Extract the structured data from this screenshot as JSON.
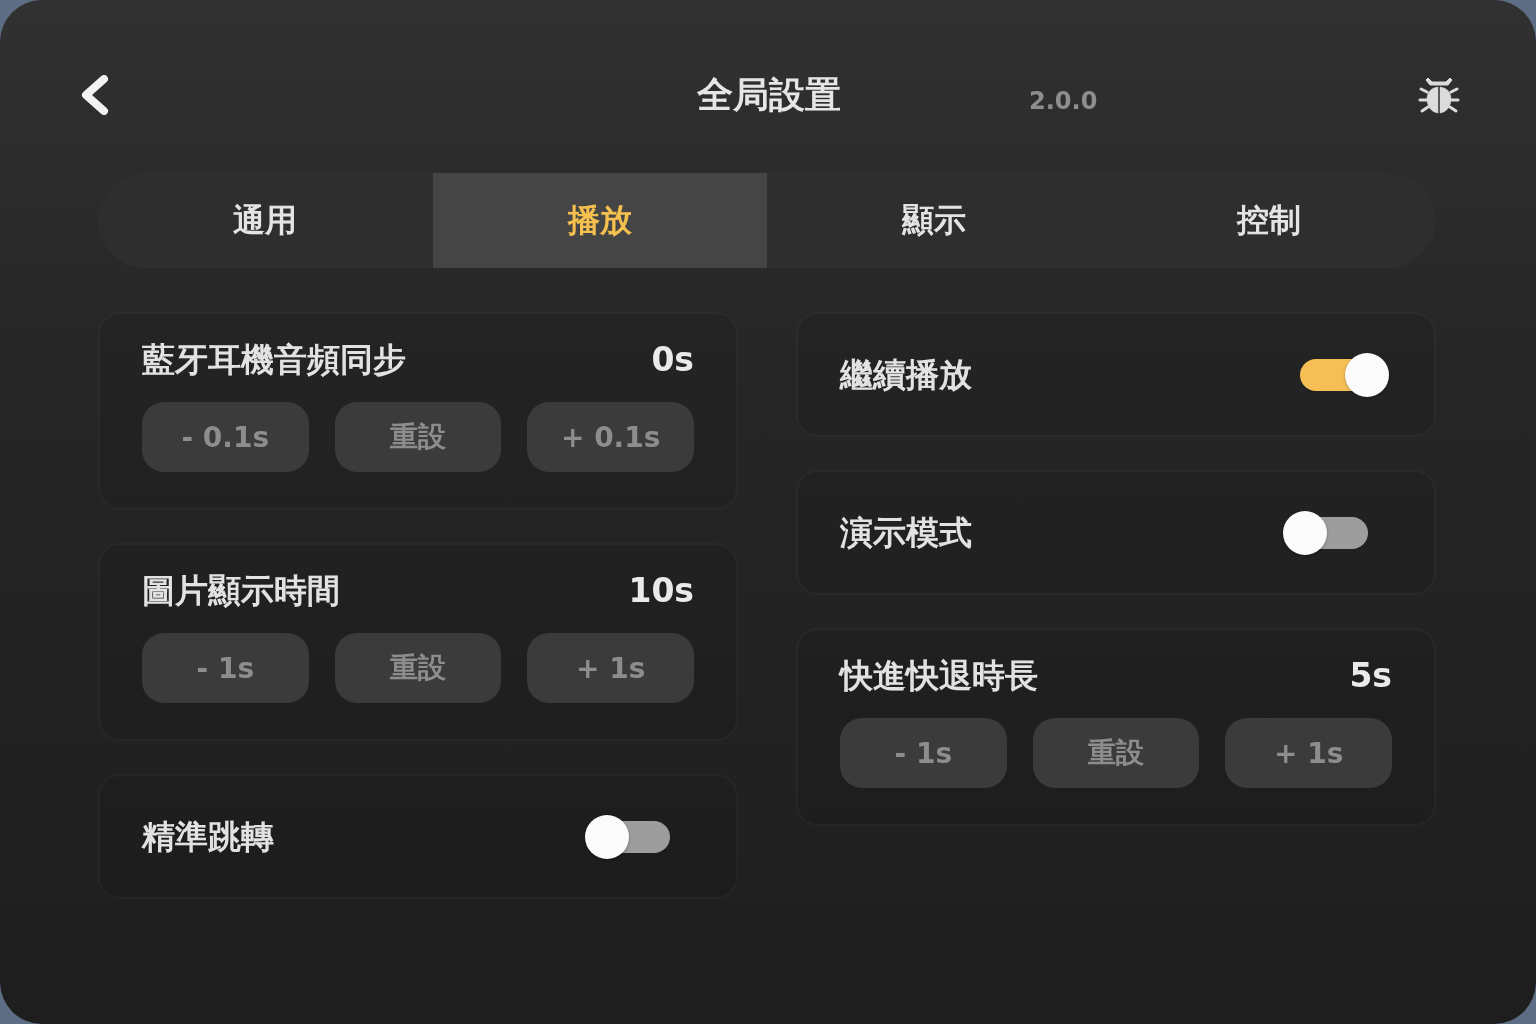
{
  "header": {
    "title": "全局設置",
    "version": "2.0.0"
  },
  "tabs": [
    {
      "label": "通用",
      "selected": false
    },
    {
      "label": "播放",
      "selected": true
    },
    {
      "label": "顯示",
      "selected": false
    },
    {
      "label": "控制",
      "selected": false
    }
  ],
  "columns": [
    {
      "cards": [
        {
          "kind": "stepper",
          "label": "藍牙耳機音頻同步",
          "value": "0s",
          "buttons": [
            "- 0.1s",
            "重設",
            "+ 0.1s"
          ]
        },
        {
          "kind": "stepper",
          "label": "圖片顯示時間",
          "value": "10s",
          "buttons": [
            "- 1s",
            "重設",
            "+ 1s"
          ]
        },
        {
          "kind": "toggle",
          "label": "精準跳轉",
          "on": false
        }
      ]
    },
    {
      "cards": [
        {
          "kind": "toggle",
          "label": "繼續播放",
          "on": true
        },
        {
          "kind": "toggle",
          "label": "演示模式",
          "on": false
        },
        {
          "kind": "stepper",
          "label": "快進快退時長",
          "value": "5s",
          "buttons": [
            "- 1s",
            "重設",
            "+ 1s"
          ]
        }
      ]
    }
  ]
}
